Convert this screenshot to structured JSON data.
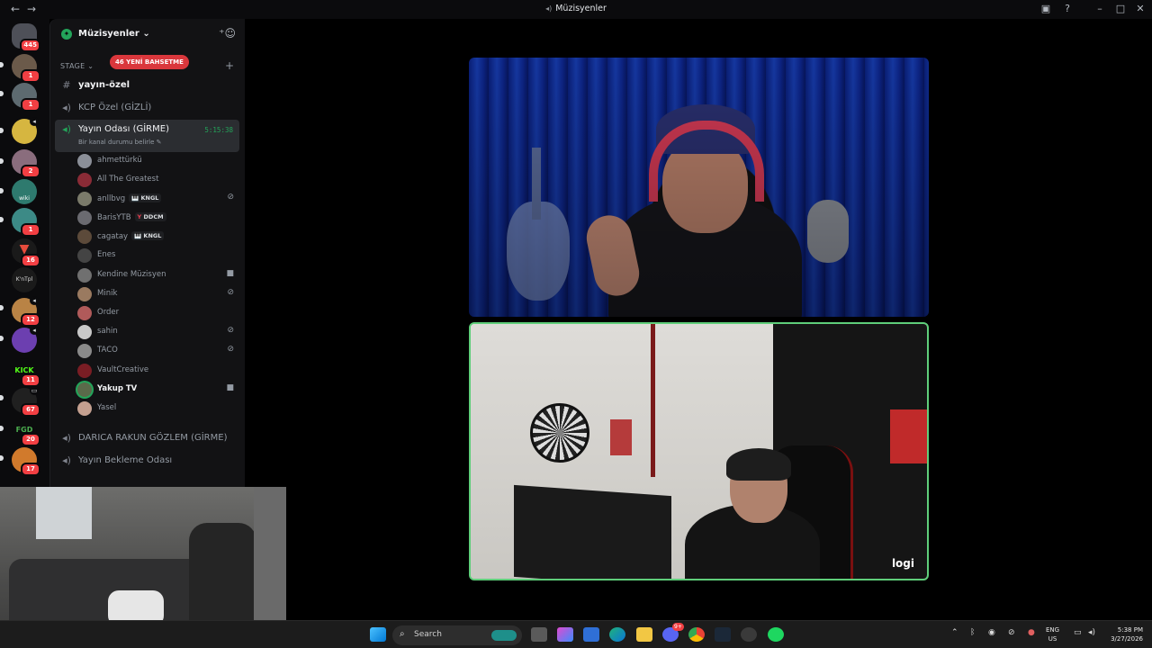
{
  "window": {
    "title": "Müzisyenler",
    "back_icon": "arrow-left",
    "forward_icon": "arrow-right",
    "controls": [
      "inbox",
      "help",
      "minimize",
      "maximize",
      "close"
    ]
  },
  "rail": {
    "servers": [
      {
        "badge": "445"
      },
      {
        "badge": "1"
      },
      {
        "badge": "1"
      },
      {
        "badge": ""
      },
      {
        "badge": "2"
      },
      {
        "badge": "",
        "label": "wiki"
      },
      {
        "badge": "1"
      },
      {
        "badge": "16"
      },
      {
        "badge": "",
        "label": "K'nTpl"
      },
      {
        "badge": "12"
      },
      {
        "badge": ""
      },
      {
        "badge": "11",
        "label": "KICK"
      },
      {
        "badge": "67"
      },
      {
        "badge": "20",
        "label": "FGD"
      },
      {
        "badge": "17"
      }
    ]
  },
  "server": {
    "name": "Müzisyenler",
    "category": "STAGE",
    "mentions_pill": "46 YENİ BAHSETME",
    "channels": {
      "c1": "yayın-özel",
      "c2": "KCP Özel (GİZLİ)",
      "c3": "Yayın Odası (GİRME)",
      "c3_timer": "5:15:38",
      "c3_status": "Bir kanal durumu belirle",
      "c4": "DARICA RAKUN GÖZLEM (GİRME)",
      "c5": "Yayın Bekleme Odası"
    },
    "users": [
      {
        "name": "ahmettürkü",
        "tag": "",
        "icon": ""
      },
      {
        "name": "All The Greatest",
        "tag": "",
        "icon": ""
      },
      {
        "name": "anllbvg",
        "tag": "KNGL",
        "icon": "muted-headset"
      },
      {
        "name": "BarisYTB",
        "tag": "DDCM",
        "icon": ""
      },
      {
        "name": "cagatay",
        "tag": "KNGL",
        "icon": ""
      },
      {
        "name": "Enes",
        "tag": "",
        "icon": ""
      },
      {
        "name": "Kendine Müzisyen",
        "tag": "",
        "icon": "camera"
      },
      {
        "name": "Minik",
        "tag": "",
        "icon": "muted-headset"
      },
      {
        "name": "Order",
        "tag": "",
        "icon": ""
      },
      {
        "name": "sahin",
        "tag": "",
        "icon": "muted-headset"
      },
      {
        "name": "TACO",
        "tag": "",
        "icon": "muted-headset"
      },
      {
        "name": "VaultCreative",
        "tag": "",
        "icon": ""
      },
      {
        "name": "Yakup TV",
        "tag": "",
        "icon": "camera"
      },
      {
        "name": "Yasel",
        "tag": "",
        "icon": ""
      }
    ]
  },
  "video": {
    "logo_text": "logi"
  },
  "taskbar": {
    "search_placeholder": "Search",
    "discord_badge": "9+",
    "lang_line1": "ENG",
    "lang_line2": "US",
    "time": "5:38 PM",
    "date": "3/27/2026"
  },
  "colors": {
    "green": "#23a55a",
    "red_badge": "#f23f43",
    "mention_pill": "#da373c",
    "video_border": "#5fce7a"
  }
}
